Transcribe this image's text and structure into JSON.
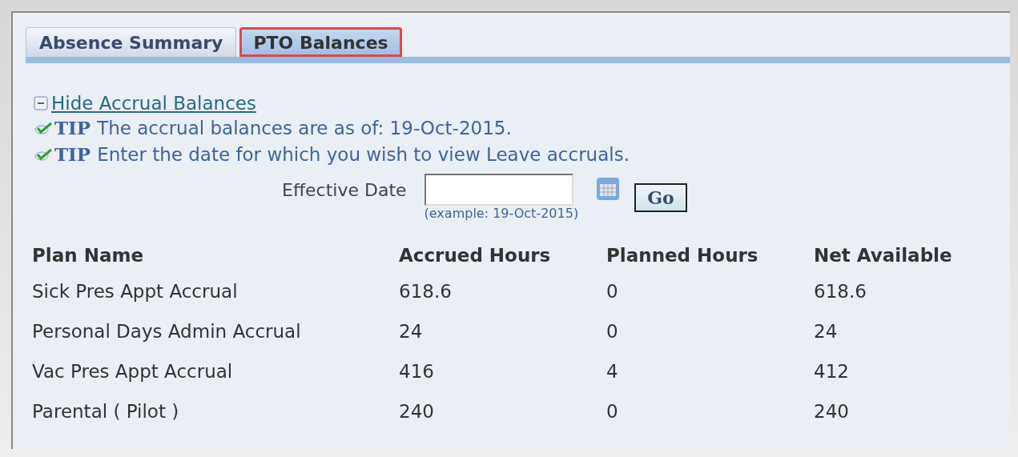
{
  "tabs": [
    {
      "label": "Absence Summary",
      "selected": false,
      "highlighted": false
    },
    {
      "label": "PTO Balances",
      "selected": true,
      "highlighted": true
    }
  ],
  "toggle": {
    "label": "Hide Accrual Balances",
    "expanded": true
  },
  "tips": [
    {
      "label": "TIP",
      "text": "The accrual balances are as of: 19-Oct-2015."
    },
    {
      "label": "TIP",
      "text": "Enter the date for which you wish to view Leave accruals."
    }
  ],
  "effective_date": {
    "label": "Effective Date",
    "hint": "(example: 19-Oct-2015)",
    "button": "Go"
  },
  "table": {
    "columns": [
      "Plan Name",
      "Accrued Hours",
      "Planned Hours",
      "Net Available"
    ],
    "rows": [
      [
        "Sick Pres Appt Accrual",
        "618.6",
        "0",
        "618.6"
      ],
      [
        "Personal Days Admin Accrual",
        "24",
        "0",
        "24"
      ],
      [
        "Vac Pres Appt Accrual",
        "416",
        "4",
        "412"
      ],
      [
        "Parental ( Pilot )",
        "240",
        "0",
        "240"
      ]
    ]
  }
}
